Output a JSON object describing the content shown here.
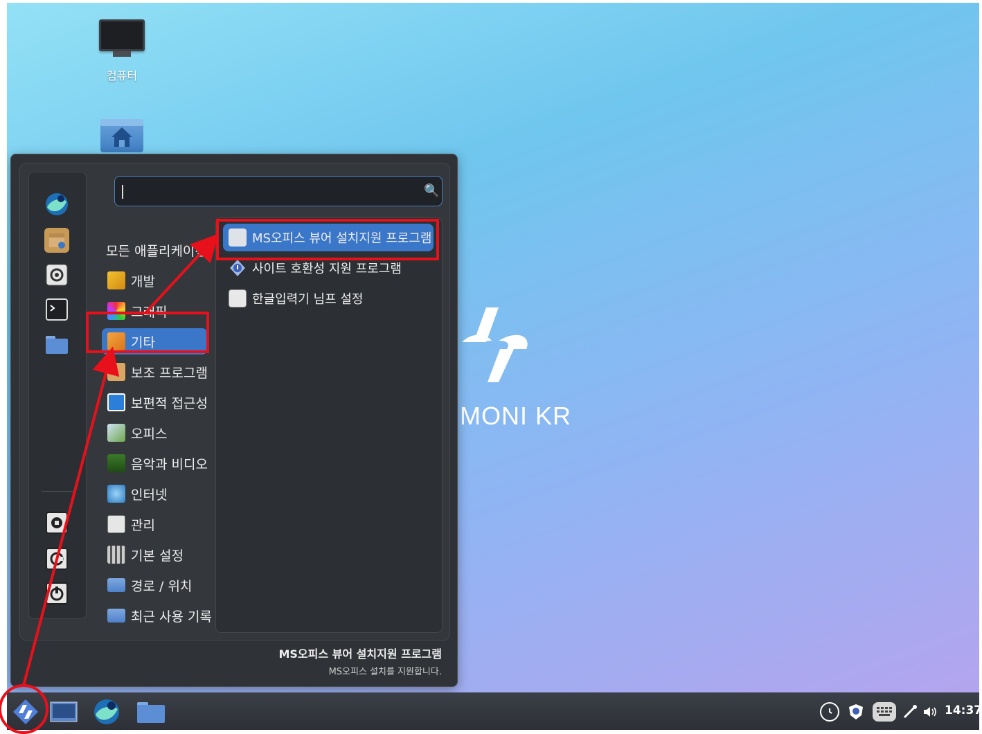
{
  "desktop": {
    "icons": [
      {
        "label": "컴퓨터",
        "icon": "monitor-icon"
      },
      {
        "label": "",
        "icon": "home-folder-icon"
      }
    ],
    "logo_text": "MONI KR"
  },
  "menu": {
    "search": {
      "value": "",
      "placeholder": ""
    },
    "favorites": [
      "hamonikr-browser-icon",
      "package-installer-icon",
      "system-settings-icon",
      "terminal-icon",
      "folder-icon"
    ],
    "session_buttons": [
      "lock-screen-icon",
      "logout-icon",
      "power-icon"
    ],
    "categories": [
      {
        "label": "모든 애플리케이션",
        "icon": ""
      },
      {
        "label": "개발",
        "icon": "development-icon"
      },
      {
        "label": "그래픽",
        "icon": "graphics-icon"
      },
      {
        "label": "기타",
        "icon": "other-icon",
        "selected": true
      },
      {
        "label": "보조 프로그램",
        "icon": "accessories-icon"
      },
      {
        "label": "보편적 접근성",
        "icon": "accessibility-icon"
      },
      {
        "label": "오피스",
        "icon": "office-icon"
      },
      {
        "label": "음악과 비디오",
        "icon": "multimedia-icon"
      },
      {
        "label": "인터넷",
        "icon": "internet-icon"
      },
      {
        "label": "관리",
        "icon": "administration-icon"
      },
      {
        "label": "기본 설정",
        "icon": "preferences-icon"
      },
      {
        "label": "경로 / 위치",
        "icon": "places-icon"
      },
      {
        "label": "최근 사용 기록",
        "icon": "recent-icon"
      }
    ],
    "apps": [
      {
        "label": "MS오피스 뷰어 설치지원 프로그램",
        "icon": "ms-office-viewer-icon",
        "selected": true
      },
      {
        "label": "사이트 호환성 지원 프로그램",
        "icon": "site-compat-shield-icon"
      },
      {
        "label": "한글입력기 님프 설정",
        "icon": "nimf-settings-icon"
      }
    ],
    "description": {
      "title": "MS오피스 뷰어 설치지원 프로그램",
      "subtitle": "MS오피스 설치를 지원합니다."
    }
  },
  "taskbar": {
    "clock": "14:37",
    "tray": [
      "clock-icon",
      "shield-icon",
      "keyboard-icon",
      "network-icon",
      "volume-icon"
    ]
  },
  "colors": {
    "highlight": "#3b77c8",
    "annotation": "#e8101a",
    "menu_bg": "#2f3236"
  }
}
